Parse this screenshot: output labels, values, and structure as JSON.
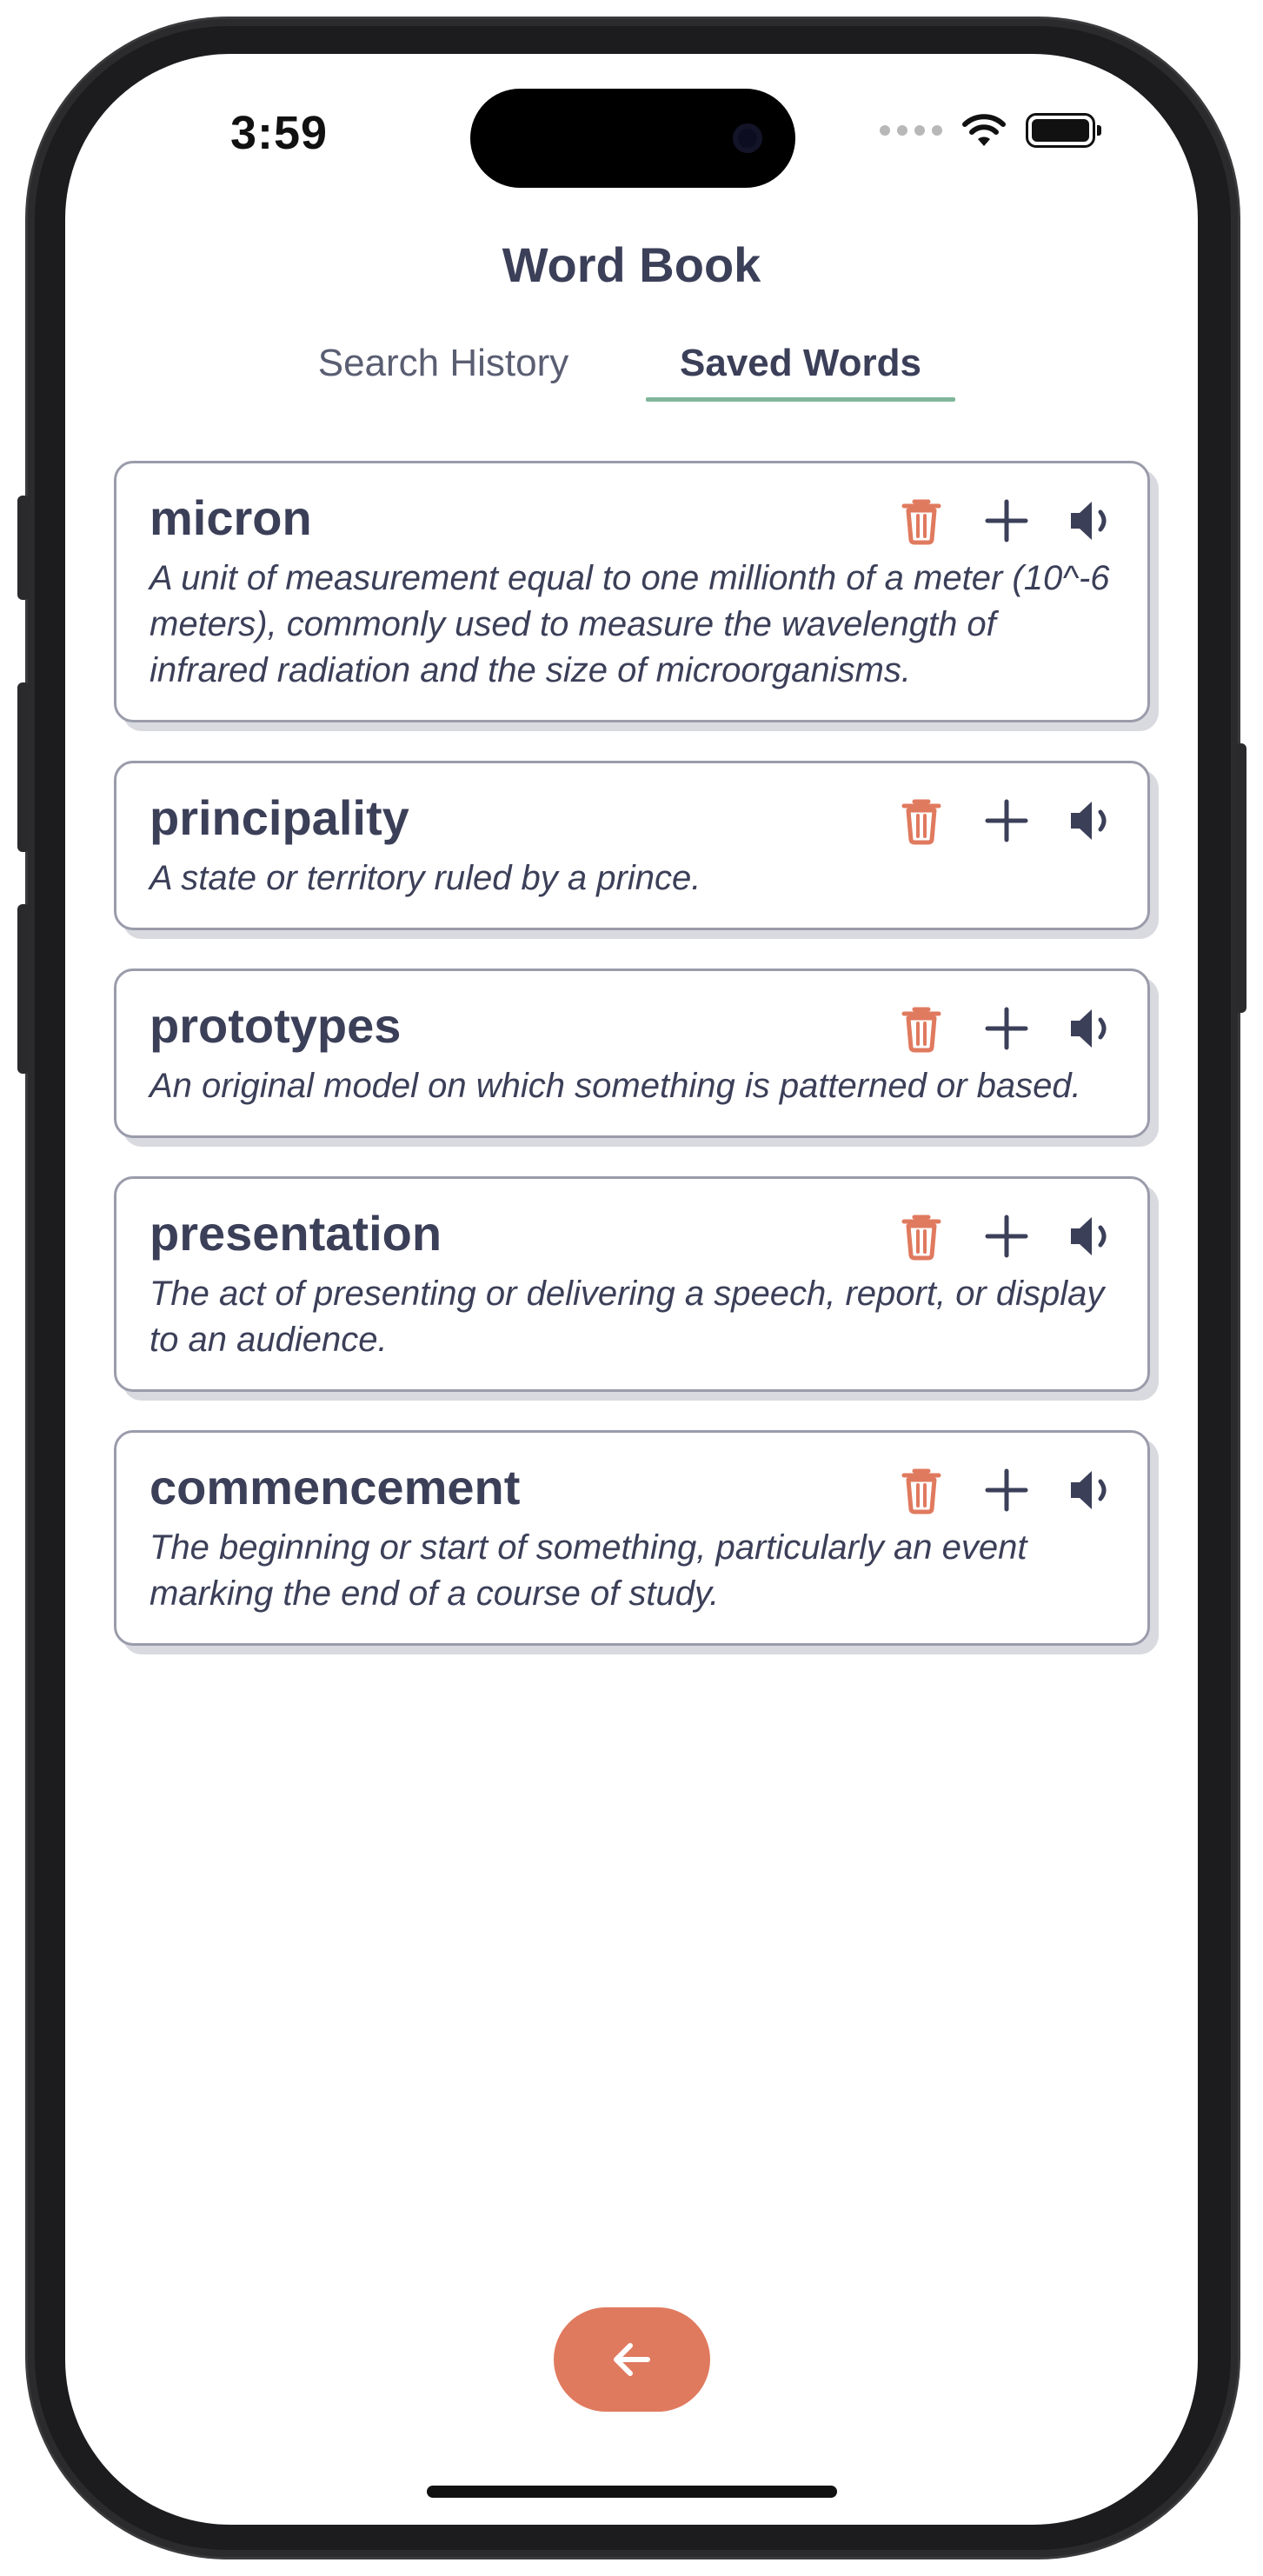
{
  "status_bar": {
    "time": "3:59",
    "icons": [
      "signal-dots-icon",
      "wifi-icon",
      "battery-icon"
    ]
  },
  "header": {
    "title": "Word Book"
  },
  "tabs": [
    {
      "label": "Search History",
      "active": false
    },
    {
      "label": "Saved Words",
      "active": true
    }
  ],
  "words": [
    {
      "word": "micron",
      "definition": "A unit of measurement equal to one millionth of a meter (10^-6 meters), commonly used to measure the wavelength of infrared radiation and the size of microorganisms."
    },
    {
      "word": "principality",
      "definition": "A state or territory ruled by a prince."
    },
    {
      "word": "prototypes",
      "definition": "An original model on which something is patterned or based."
    },
    {
      "word": "presentation",
      "definition": "The act of presenting or delivering a speech, report, or display to an audience."
    },
    {
      "word": "commencement",
      "definition": "The beginning or start of something, particularly an event marking the end of a course of study."
    }
  ],
  "card_actions": [
    "trash-icon",
    "plus-icon",
    "speaker-icon"
  ],
  "footer": {
    "back_icon": "arrow-left-icon"
  },
  "colors": {
    "text": "#3b3f58",
    "accent": "#e07a5f",
    "tab_underline": "#7fb69a",
    "card_border": "#9a9cab"
  }
}
